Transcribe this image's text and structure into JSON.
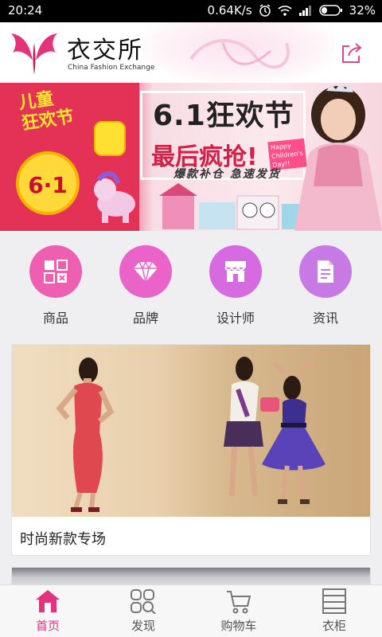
{
  "status_bar": {
    "time": "20:24",
    "network_speed": "0.64K/s",
    "battery_percent": "32%",
    "battery_level": 0.32
  },
  "header": {
    "app_name": "衣交所",
    "app_name_en": "China Fashion Exchange",
    "share_icon": "share-icon"
  },
  "banner": {
    "badge": "儿童狂欢节",
    "badge_line1": "儿童",
    "badge_line2": "狂欢节",
    "date_mark": "6·1",
    "title": "6.1狂欢节",
    "subtitle": "最后疯抢!",
    "slogan": "爆款补仓  急速发货",
    "sticker": "Happy Children's Day!!"
  },
  "categories": [
    {
      "label": "商品",
      "icon": "grid-icon",
      "color": "#ee5fb2"
    },
    {
      "label": "品牌",
      "icon": "diamond-icon",
      "color": "#e963c9"
    },
    {
      "label": "设计师",
      "icon": "shop-icon",
      "color": "#d56ae1"
    },
    {
      "label": "资讯",
      "icon": "document-icon",
      "color": "#c77ae3"
    }
  ],
  "cards": [
    {
      "caption": "时尚新款专场"
    }
  ],
  "bottom_nav": [
    {
      "label": "首页",
      "icon": "home-icon",
      "active": true
    },
    {
      "label": "发现",
      "icon": "discover-icon",
      "active": false
    },
    {
      "label": "购物车",
      "icon": "cart-icon",
      "active": false
    },
    {
      "label": "衣柜",
      "icon": "wardrobe-icon",
      "active": false
    }
  ],
  "colors": {
    "accent": "#e0357e",
    "banner_red": "#e43257",
    "inactive_nav": "#555555"
  }
}
